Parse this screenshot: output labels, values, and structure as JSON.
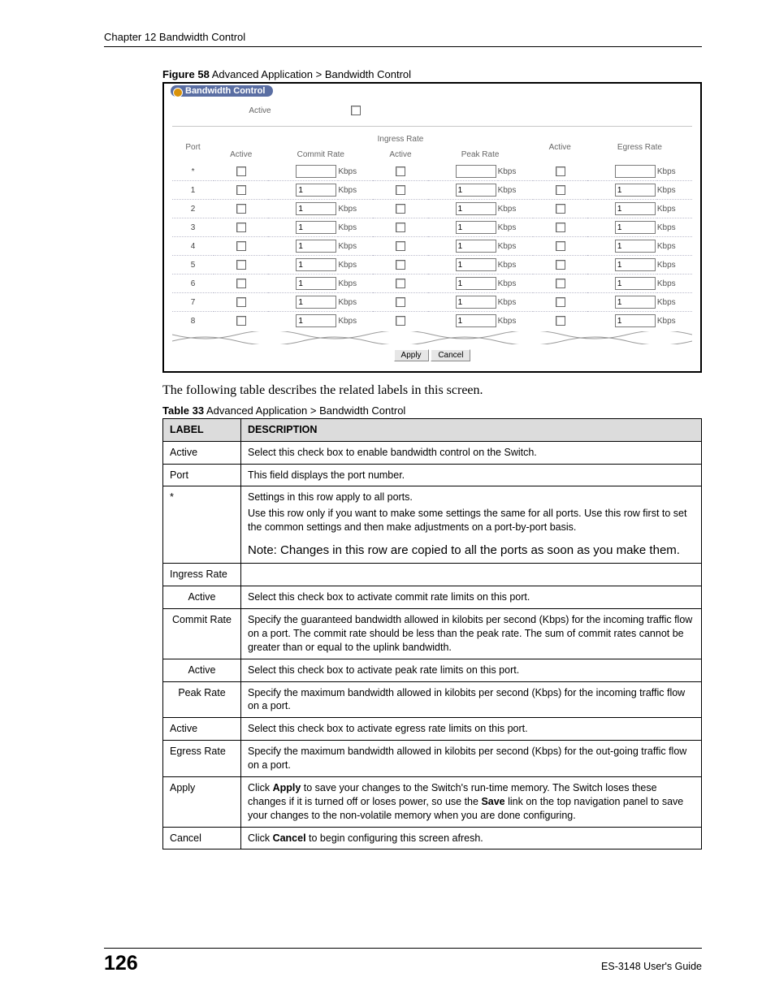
{
  "header": {
    "chapter": "Chapter 12 Bandwidth Control"
  },
  "figure": {
    "caption_bold": "Figure 58",
    "caption_text": "   Advanced Application > Bandwidth Control",
    "panel_title": "Bandwidth Control",
    "active_label": "Active",
    "cols": {
      "port": "Port",
      "active": "Active",
      "ingress": "Ingress Rate",
      "commit": "Commit Rate",
      "active2": "Active",
      "peak": "Peak Rate",
      "active3": "Active",
      "egress": "Egress Rate"
    },
    "unit": "Kbps",
    "rows": [
      {
        "port": "*",
        "commit": "",
        "peak": "",
        "egress": ""
      },
      {
        "port": "1",
        "commit": "1",
        "peak": "1",
        "egress": "1"
      },
      {
        "port": "2",
        "commit": "1",
        "peak": "1",
        "egress": "1"
      },
      {
        "port": "3",
        "commit": "1",
        "peak": "1",
        "egress": "1"
      },
      {
        "port": "4",
        "commit": "1",
        "peak": "1",
        "egress": "1"
      },
      {
        "port": "5",
        "commit": "1",
        "peak": "1",
        "egress": "1"
      },
      {
        "port": "6",
        "commit": "1",
        "peak": "1",
        "egress": "1"
      },
      {
        "port": "7",
        "commit": "1",
        "peak": "1",
        "egress": "1"
      },
      {
        "port": "8",
        "commit": "1",
        "peak": "1",
        "egress": "1"
      }
    ],
    "buttons": {
      "apply": "Apply",
      "cancel": "Cancel"
    }
  },
  "paragraph": "The following table describes the related labels in this screen.",
  "table_caption": {
    "bold": "Table 33",
    "text": "   Advanced Application > Bandwidth Control"
  },
  "desc": {
    "head": {
      "label": "LABEL",
      "description": "DESCRIPTION"
    },
    "rows": [
      {
        "label": "Active",
        "desc": "Select this check box to enable bandwidth control on the Switch."
      },
      {
        "label": "Port",
        "desc": "This field displays the port number."
      },
      {
        "label": "*",
        "desc_lines": [
          "Settings in this row apply to all ports.",
          "Use this row only if you want to make some settings the same for all ports. Use this row first to set the common settings and then make adjustments on a port-by-port basis."
        ],
        "note": "Note: Changes in this row are copied to all the ports as soon as you make them."
      },
      {
        "label": "Ingress Rate",
        "desc": ""
      },
      {
        "label": "Active",
        "indent": true,
        "desc": "Select this check box to activate commit rate limits on this port."
      },
      {
        "label": "Commit Rate",
        "indent": true,
        "desc": "Specify the guaranteed bandwidth allowed in kilobits per second (Kbps) for the incoming traffic flow on a port. The commit rate should be less than the peak rate. The sum of commit rates cannot be greater than or equal to the uplink bandwidth."
      },
      {
        "label": "Active",
        "indent": true,
        "desc": "Select this check box to activate peak rate limits on this port."
      },
      {
        "label": "Peak Rate",
        "indent": true,
        "desc": "Specify the maximum bandwidth allowed in kilobits per second (Kbps) for the incoming traffic flow on a port."
      },
      {
        "label": "Active",
        "desc": "Select this check box to activate egress rate limits on this port."
      },
      {
        "label": "Egress Rate",
        "desc": "Specify the maximum bandwidth allowed in kilobits per second (Kbps) for the out-going traffic flow on a port."
      },
      {
        "label": "Apply",
        "desc_rich": {
          "pre": "Click ",
          "b1": "Apply",
          "mid": " to save your changes to the Switch's run-time memory. The Switch loses these changes if it is turned off or loses power, so use the ",
          "b2": "Save",
          "post": " link on the top navigation panel to save your changes to the non-volatile memory when you are done configuring."
        }
      },
      {
        "label": "Cancel",
        "desc_rich2": {
          "pre": "Click ",
          "b": "Cancel",
          "post": " to begin configuring this screen afresh."
        }
      }
    ]
  },
  "footer": {
    "page": "126",
    "guide": "ES-3148 User's Guide"
  }
}
